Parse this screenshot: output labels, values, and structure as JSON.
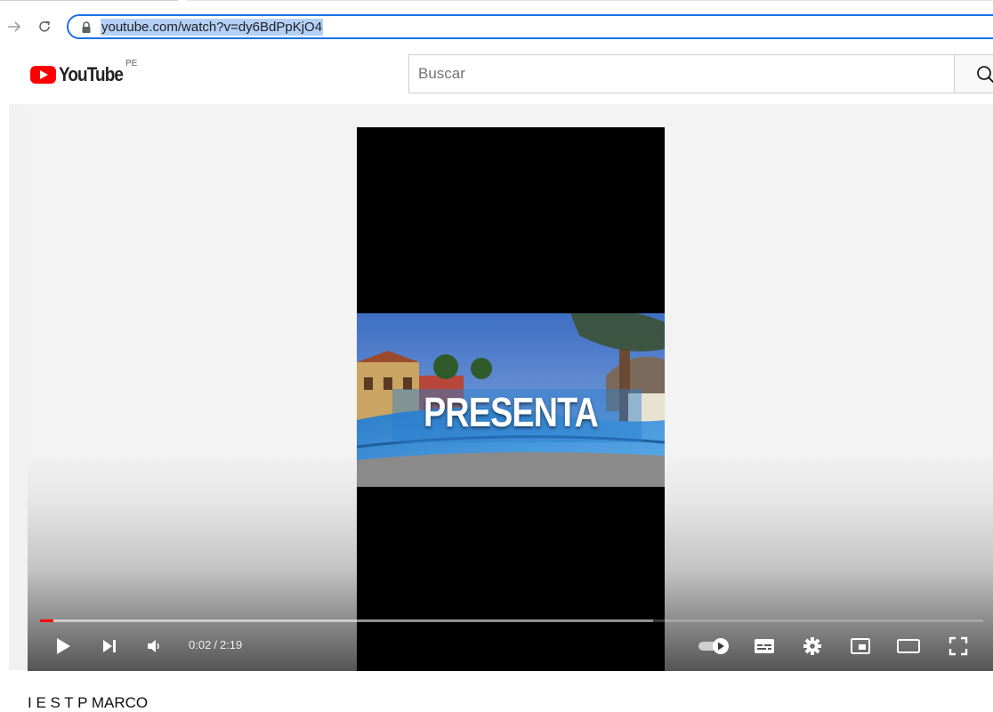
{
  "browser": {
    "url": "youtube.com/watch?v=dy6BdPpKjO4"
  },
  "header": {
    "logo_text": "YouTube",
    "country_code": "PE",
    "search": {
      "placeholder": "Buscar"
    }
  },
  "player": {
    "overlay_text": "PRESENTA",
    "time_current": "0:02",
    "time_separator": "/",
    "time_duration": "2:19",
    "progress_played_fraction": 0.0144,
    "progress_buffered_fraction": 0.65,
    "accent_color": "#ff0000",
    "controls": [
      "play-icon",
      "next-icon",
      "volume-icon",
      "autoplay-toggle",
      "subtitles-icon",
      "settings-icon",
      "miniplayer-icon",
      "theater-mode-icon",
      "fullscreen-icon"
    ]
  },
  "video": {
    "title": "I E S T P MARCO"
  },
  "colors": {
    "brand_red": "#ff0000",
    "omnibox_focus": "#1a73e8"
  }
}
